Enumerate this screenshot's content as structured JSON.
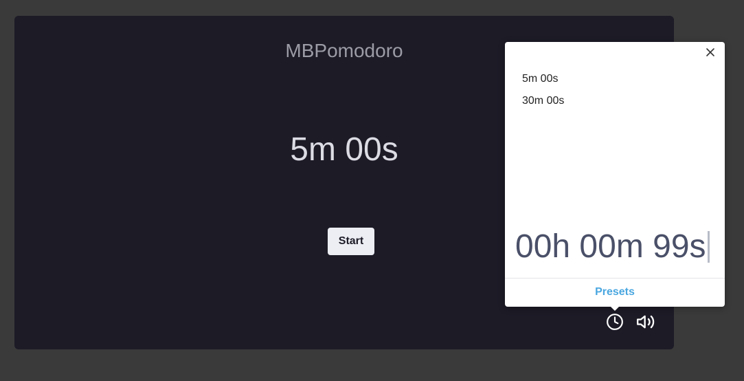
{
  "app": {
    "title": "MBPomodoro",
    "timer_display": "5m 00s",
    "start_label": "Start"
  },
  "controls": {
    "timer_icon": "clock-icon",
    "sound_icon": "volume-icon"
  },
  "popover": {
    "close_icon": "close-icon",
    "presets": [
      "5m 00s",
      "30m 00s"
    ],
    "time_input_value": "00h 00m 99s",
    "tab_label": "Presets",
    "accent_color": "#4aa7e0"
  }
}
